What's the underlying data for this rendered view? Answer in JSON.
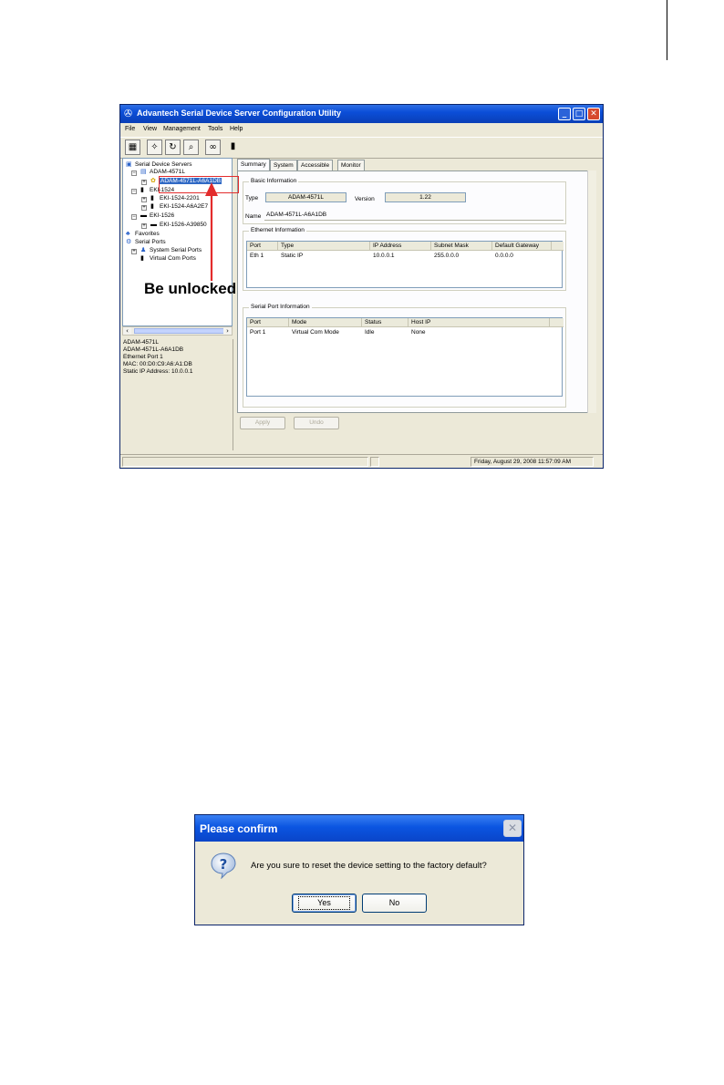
{
  "main_window": {
    "title": "Advantech Serial Device Server Configuration Utility",
    "menu": [
      "File",
      "View",
      "Management",
      "Tools",
      "Help"
    ],
    "tree": {
      "root": "Serial Device Servers",
      "adam_group": "ADAM-4571L",
      "adam_device": "ADAM-4571L-A6A1DB",
      "eki1524_group": "EKI-1524",
      "eki1524_dev1": "EKI-1524-2201",
      "eki1524_dev2": "EKI-1524-A6A2E7",
      "eki1526_group": "EKI-1526",
      "eki1526_dev1": "EKI-1526-A39850",
      "favorites": "Favorites",
      "serial_ports": "Serial Ports",
      "system_serial_ports": "System Serial Ports",
      "virtual_com_ports": "Virtual Com Ports"
    },
    "device_info": [
      "ADAM-4571L",
      "ADAM-4571L-A6A1DB",
      "Ethernet Port 1",
      "MAC: 00:D0:C9:A6:A1:DB",
      "Static IP Address: 10.0.0.1"
    ],
    "tabs": [
      "Summary",
      "System",
      "Accessible",
      "Monitor"
    ],
    "basic_information": {
      "legend": "Basic Information",
      "type_label": "Type",
      "type_value": "ADAM-4571L",
      "version_label": "Version",
      "version_value": "1.22",
      "name_label": "Name",
      "name_value": "ADAM-4571L-A6A1DB"
    },
    "ethernet_information": {
      "legend": "Ethernet Information",
      "columns": [
        "Port",
        "Type",
        "IP Address",
        "Subnet Mask",
        "Default Gateway"
      ],
      "rows": [
        [
          "Eth 1",
          "Static IP",
          "10.0.0.1",
          "255.0.0.0",
          "0.0.0.0"
        ]
      ]
    },
    "serial_port_information": {
      "legend": "Serial Port Information",
      "columns": [
        "Port",
        "Mode",
        "Status",
        "Host IP"
      ],
      "rows": [
        [
          "Port 1",
          "Virtual Com Mode",
          "Idle",
          "None"
        ]
      ]
    },
    "apply_label": "Apply",
    "undo_label": "Undo",
    "status_datetime": "Friday, August 29, 2008  11:57:09 AM"
  },
  "annotation": {
    "text": "Be unlocked",
    "color": "#e32c2c"
  },
  "confirm_dialog": {
    "title": "Please confirm",
    "message": "Are you sure to reset the device setting to the factory default?",
    "yes_label": "Yes",
    "no_label": "No",
    "icon": "question-icon"
  }
}
